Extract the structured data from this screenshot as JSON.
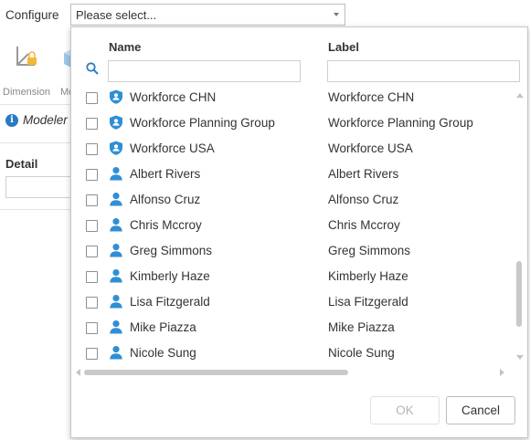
{
  "topbar": {
    "configure_label": "Configure",
    "select_value": "Please select..."
  },
  "toolbar": {
    "items": [
      {
        "label": "Dimension",
        "icon": "dimension-lock-icon"
      },
      {
        "label": "Mo",
        "icon": "cube-icon"
      }
    ]
  },
  "panel": {
    "modeler_label": "Modeler",
    "detail_label": "Detail"
  },
  "popup": {
    "columns": {
      "name": "Name",
      "label": "Label"
    },
    "filters": {
      "name_value": "",
      "label_value": ""
    },
    "rows": [
      {
        "type": "group",
        "icon": "group-shield-icon",
        "name": "Workforce CHN",
        "label": "Workforce CHN",
        "checked": false
      },
      {
        "type": "group",
        "icon": "group-shield-icon",
        "name": "Workforce Planning Group",
        "label": "Workforce Planning Group",
        "checked": false
      },
      {
        "type": "group",
        "icon": "group-shield-icon",
        "name": "Workforce USA",
        "label": "Workforce USA",
        "checked": false
      },
      {
        "type": "user",
        "icon": "user-icon",
        "name": "Albert Rivers",
        "label": "Albert Rivers",
        "checked": false
      },
      {
        "type": "user",
        "icon": "user-icon",
        "name": "Alfonso Cruz",
        "label": "Alfonso Cruz",
        "checked": false
      },
      {
        "type": "user",
        "icon": "user-icon",
        "name": "Chris Mccroy",
        "label": "Chris Mccroy",
        "checked": false
      },
      {
        "type": "user",
        "icon": "user-icon",
        "name": "Greg Simmons",
        "label": "Greg Simmons",
        "checked": false
      },
      {
        "type": "user",
        "icon": "user-icon",
        "name": "Kimberly Haze",
        "label": "Kimberly Haze",
        "checked": false
      },
      {
        "type": "user",
        "icon": "user-icon",
        "name": "Lisa Fitzgerald",
        "label": "Lisa Fitzgerald",
        "checked": false
      },
      {
        "type": "user",
        "icon": "user-icon",
        "name": "Mike Piazza",
        "label": "Mike Piazza",
        "checked": false
      },
      {
        "type": "user",
        "icon": "user-icon",
        "name": "Nicole Sung",
        "label": "Nicole Sung",
        "checked": false
      }
    ],
    "buttons": {
      "ok": "OK",
      "cancel": "Cancel",
      "ok_disabled": true
    }
  },
  "colors": {
    "accent": "#2a7ac0",
    "icon_blue": "#2f8fd6",
    "border": "#c8c8c8",
    "disabled_text": "#b5b5b5"
  }
}
